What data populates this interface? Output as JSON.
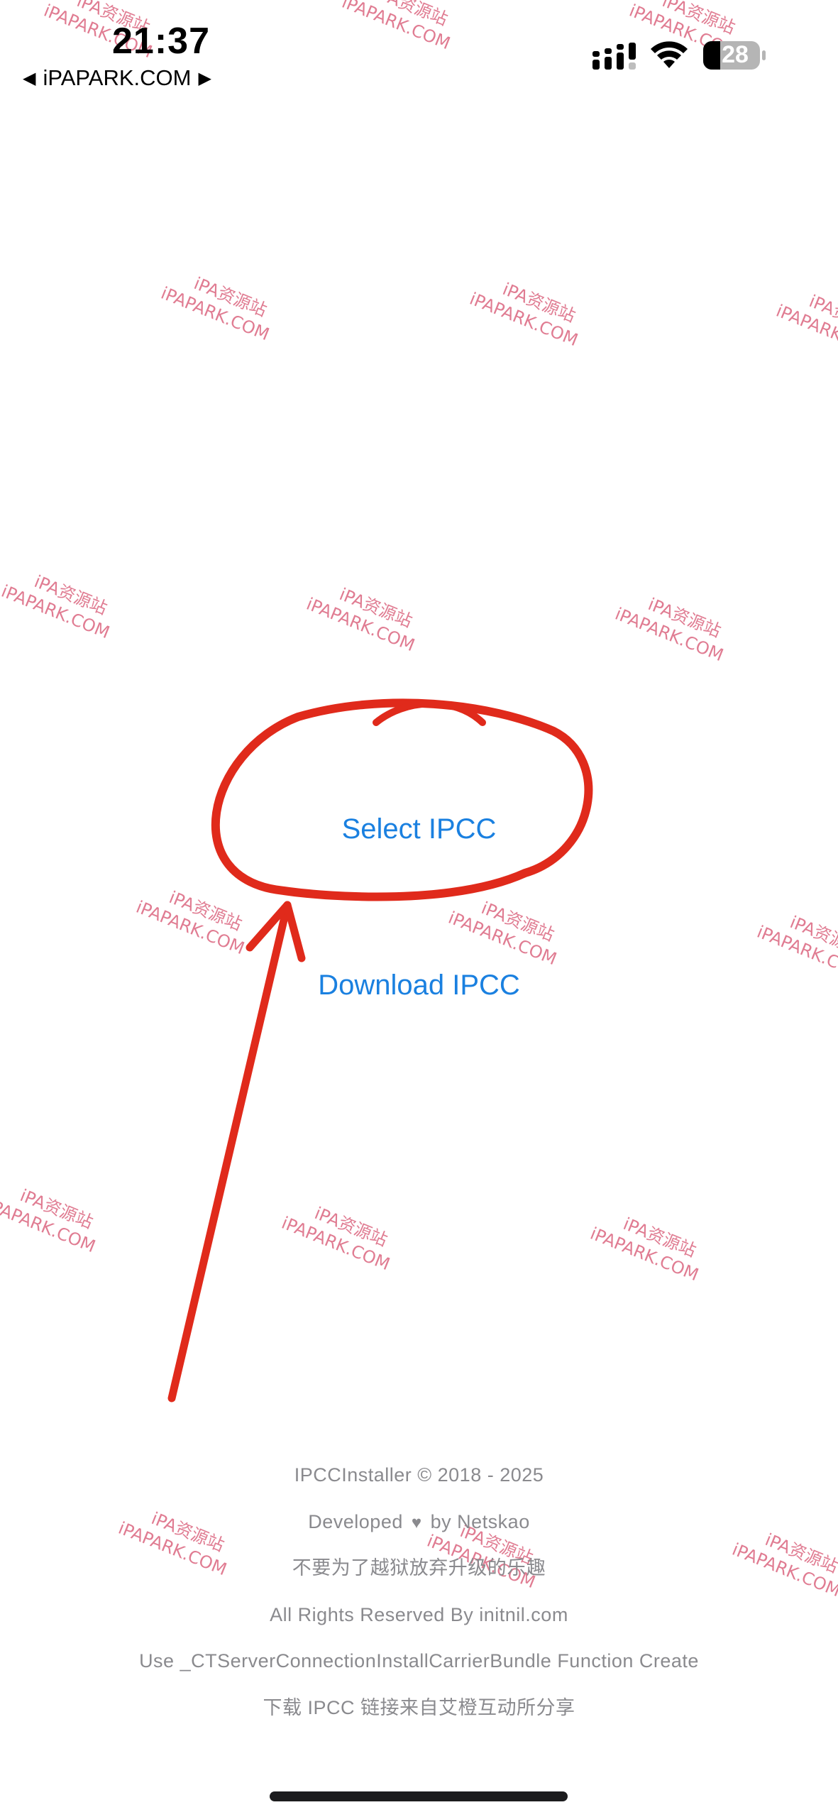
{
  "status_bar": {
    "time": "21:37",
    "back_label": "iPAPARK.COM",
    "battery_level": "28",
    "signal_icon": "cellular-signal-icon",
    "wifi_icon": "wifi-icon"
  },
  "actions": {
    "select_label": "Select IPCC",
    "download_label": "Download IPCC"
  },
  "footer": {
    "copyright": "IPCCInstaller © 2018 - 2025",
    "developed_prefix": "Developed",
    "developed_suffix": "by Netskao",
    "slogan": "不要为了越狱放弃升级的乐趣",
    "rights": "All Rights Reserved By initnil.com",
    "function_note": "Use _CTServerConnectionInstallCarrierBundle Function Create",
    "share_note": "下载 IPCC 链接来自艾橙互动所分享"
  },
  "watermark": {
    "line1": "iPA资源站",
    "line2": "iPAPARK.COM"
  },
  "colors": {
    "link": "#1a80e0",
    "annotation": "#e02a1b",
    "footer_text": "#8a8a8e",
    "watermark": "#d6506e"
  }
}
